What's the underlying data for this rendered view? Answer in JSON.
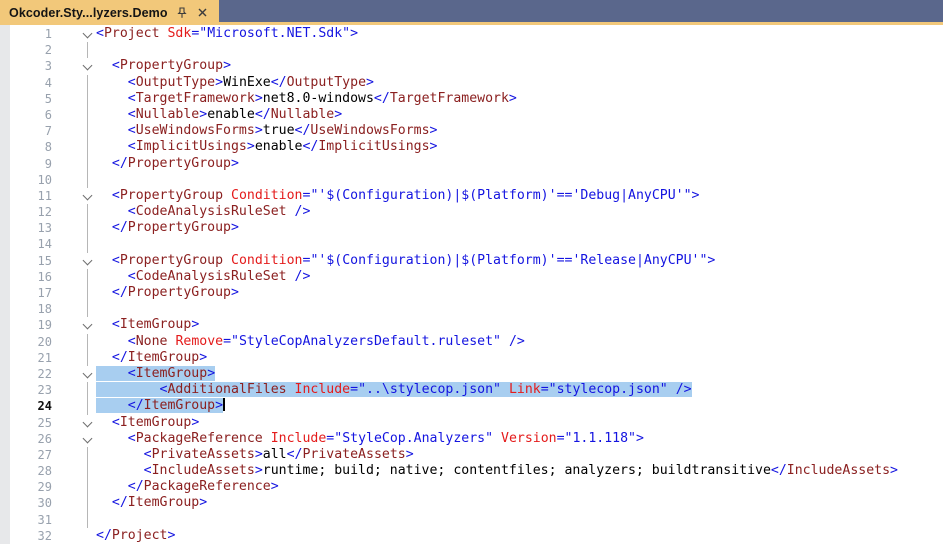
{
  "tab": {
    "title": "Okcoder.Sty...lyzers.Demo",
    "pin_icon": "pin-icon",
    "close_icon": "close-icon",
    "tab_color": "#F2C87A",
    "tab_well_color": "#5A678C"
  },
  "editor": {
    "language": "xml",
    "current_line": 24,
    "caret_line": 24,
    "selected_lines": [
      22,
      23,
      24
    ],
    "fold_lines": [
      1,
      3,
      11,
      15,
      19,
      22,
      25,
      26
    ],
    "colors": {
      "tag": "#8B2020",
      "attr": "#E41B1B",
      "blue": "#1414E0",
      "selection": "#A8CEF0",
      "line_number": "#98A1AD"
    },
    "lines": [
      "<Project Sdk=\"Microsoft.NET.Sdk\">",
      "",
      "  <PropertyGroup>",
      "    <OutputType>WinExe</OutputType>",
      "    <TargetFramework>net8.0-windows</TargetFramework>",
      "    <Nullable>enable</Nullable>",
      "    <UseWindowsForms>true</UseWindowsForms>",
      "    <ImplicitUsings>enable</ImplicitUsings>",
      "  </PropertyGroup>",
      "",
      "  <PropertyGroup Condition=\"'$(Configuration)|$(Platform)'=='Debug|AnyCPU'\">",
      "    <CodeAnalysisRuleSet />",
      "  </PropertyGroup>",
      "",
      "  <PropertyGroup Condition=\"'$(Configuration)|$(Platform)'=='Release|AnyCPU'\">",
      "    <CodeAnalysisRuleSet />",
      "  </PropertyGroup>",
      "",
      "  <ItemGroup>",
      "    <None Remove=\"StyleCopAnalyzersDefault.ruleset\" />",
      "  </ItemGroup>",
      "    <ItemGroup>",
      "        <AdditionalFiles Include=\"..\\stylecop.json\" Link=\"stylecop.json\" />",
      "    </ItemGroup>",
      "  <ItemGroup>",
      "    <PackageReference Include=\"StyleCop.Analyzers\" Version=\"1.1.118\">",
      "      <PrivateAssets>all</PrivateAssets>",
      "      <IncludeAssets>runtime; build; native; contentfiles; analyzers; buildtransitive</IncludeAssets>",
      "    </PackageReference>",
      "  </ItemGroup>",
      "",
      "</Project>"
    ]
  }
}
